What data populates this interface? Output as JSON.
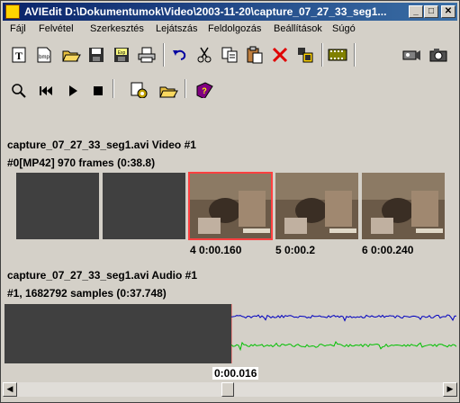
{
  "window": {
    "title": "AVIEdit D:\\Dokumentumok\\Video\\2003-11-20\\capture_07_27_33_seg1...",
    "min_symbol": "_",
    "max_symbol": "□",
    "close_symbol": "✕"
  },
  "menu": [
    "Fájl",
    "Felvétel",
    "Szerkesztés",
    "Lejátszás",
    "Feldolgozás",
    "Beállítások",
    "Súgó"
  ],
  "toolbar1_icons": [
    "text-icon",
    "bmp-icon",
    "open-folder-icon",
    "save-icon",
    "export-icon",
    "print-icon",
    "undo-icon",
    "cut-icon",
    "copy-icon",
    "paste-icon",
    "delete-icon",
    "insert-icon",
    "film-icon",
    "capture-camera-icon",
    "snapshot-camera-icon"
  ],
  "toolbar2_icons": [
    "zoom-icon",
    "rewind-icon",
    "play-icon",
    "stop-icon",
    "process-gear-icon",
    "open-folder-icon",
    "help-book-icon"
  ],
  "video": {
    "stream_title": "capture_07_27_33_seg1.avi Video #1",
    "stream_info": "#0[MP42] 970 frames (0:38.8)",
    "frames": [
      {
        "caption": ""
      },
      {
        "caption": ""
      },
      {
        "caption": "4 0:00.160"
      },
      {
        "caption": "5 0:00.2"
      },
      {
        "caption": "6 0:00.240"
      }
    ]
  },
  "audio": {
    "stream_title": "capture_07_27_33_seg1.avi Audio #1",
    "stream_info": "#1, 1682792 samples (0:37.748)",
    "cursor_time": "0:00.016",
    "wave_colors": [
      "#0000c0",
      "#00c000"
    ]
  },
  "colors": {
    "title_start": "#0a246a",
    "title_end": "#3a6ea5",
    "selection": "#ff4040"
  }
}
